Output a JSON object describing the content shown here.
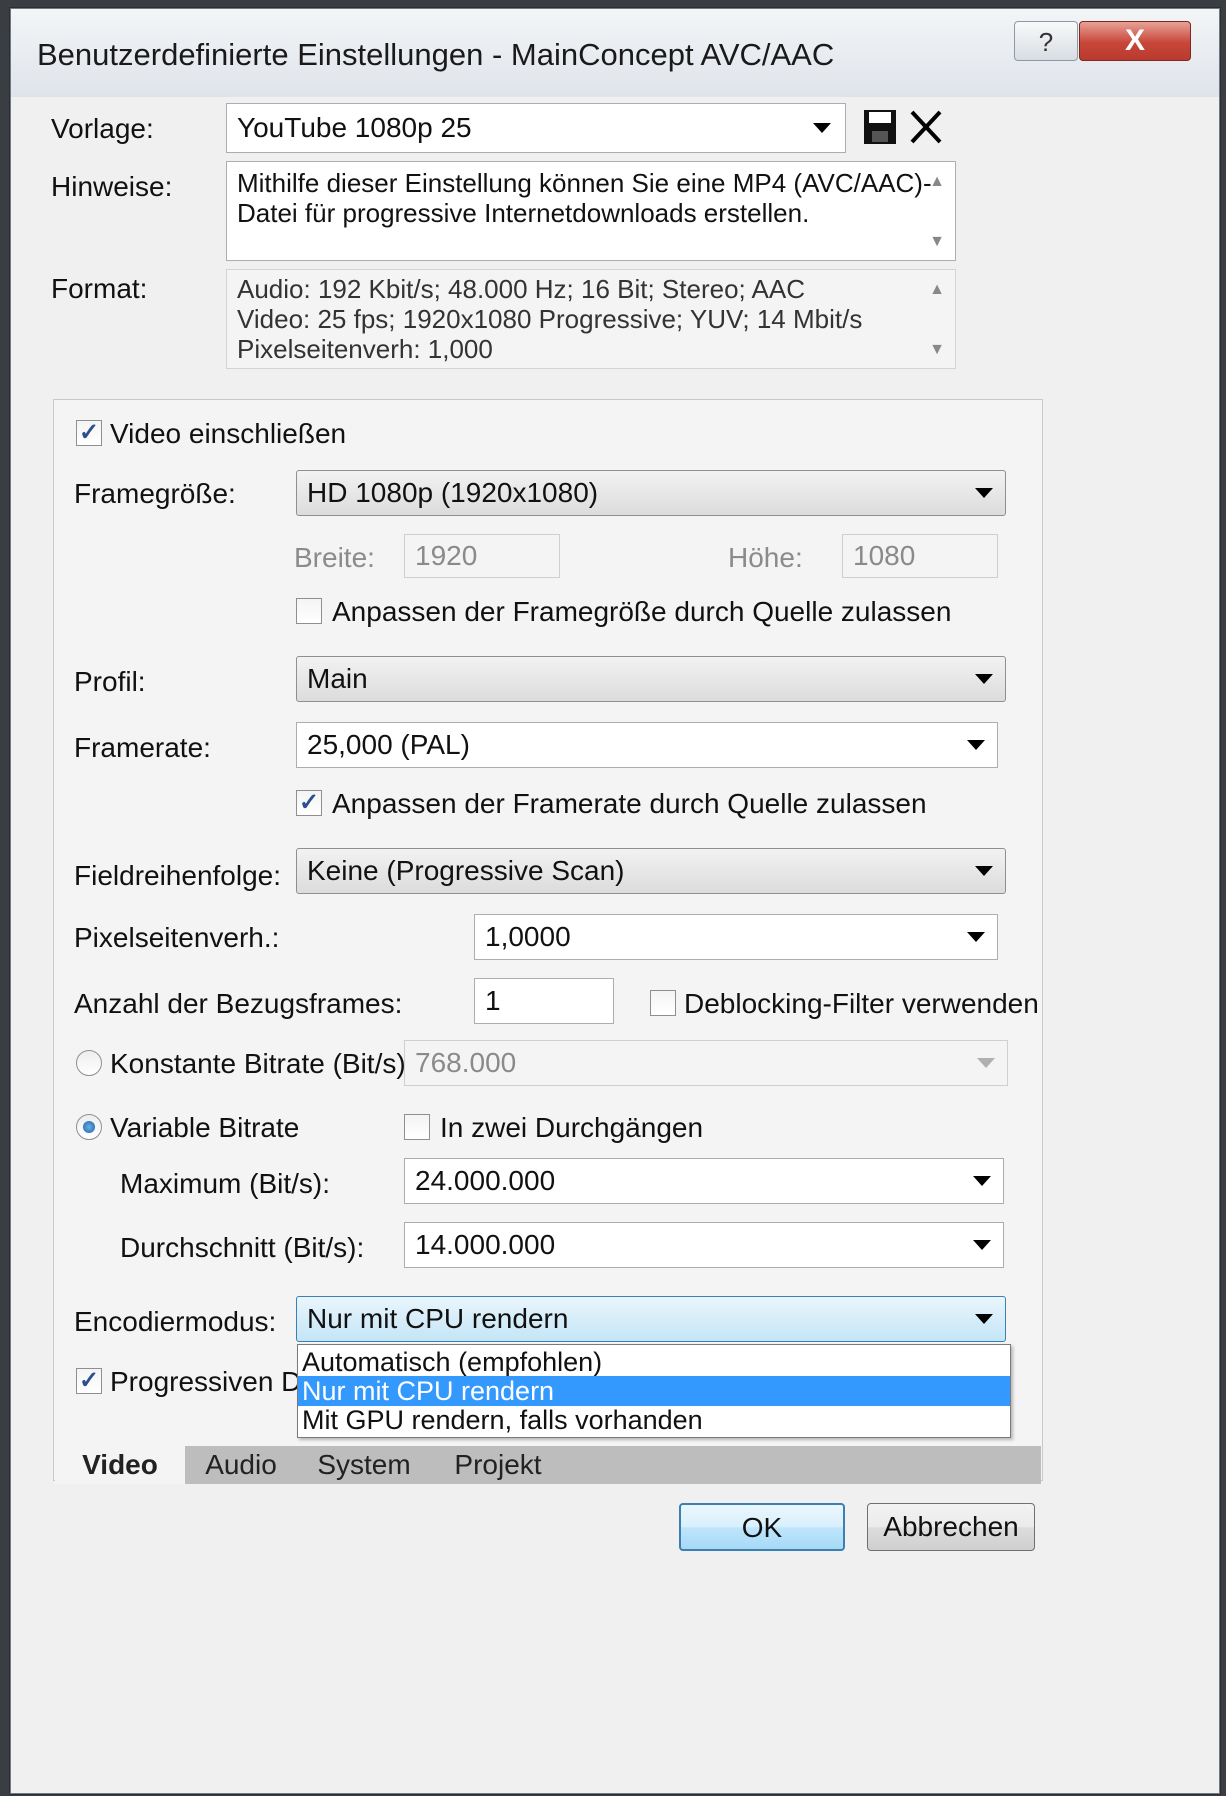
{
  "window": {
    "title": "Benutzerdefinierte Einstellungen - MainConcept AVC/AAC",
    "help_label": "?",
    "close_label": "X"
  },
  "template": {
    "vorlage_label": "Vorlage:",
    "vorlage_value": "YouTube 1080p 25",
    "save_icon": "floppy-disk-icon",
    "delete_icon": "x-delete-icon",
    "hinweise_label": "Hinweise:",
    "hinweise_lines": [
      "Mithilfe dieser Einstellung können Sie eine MP4 (AVC/AAC)-",
      "Datei für progressive Internetdownloads erstellen."
    ],
    "format_label": "Format:",
    "format_lines": [
      "Audio: 192 Kbit/s; 48.000 Hz; 16 Bit; Stereo; AAC",
      "Video: 25 fps; 1920x1080 Progressive; YUV; 14 Mbit/s",
      "Pixelseitenverh: 1,000"
    ]
  },
  "video": {
    "include_video_label": "Video einschließen",
    "include_video_checked": true,
    "framesize_label": "Framegröße:",
    "framesize_value": "HD 1080p (1920x1080)",
    "width_label": "Breite:",
    "width_value": "1920",
    "height_label": "Höhe:",
    "height_value": "1080",
    "allow_framesize_label": "Anpassen der Framegröße durch Quelle zulassen",
    "allow_framesize_checked": false,
    "profile_label": "Profil:",
    "profile_value": "Main",
    "framerate_label": "Framerate:",
    "framerate_value": "25,000 (PAL)",
    "allow_framerate_label": "Anpassen der Framerate durch Quelle zulassen",
    "allow_framerate_checked": true,
    "field_order_label": "Fieldreihenfolge:",
    "field_order_value": "Keine (Progressive Scan)",
    "pixel_aspect_label": "Pixelseitenverh.:",
    "pixel_aspect_value": "1,0000",
    "ref_frames_label": "Anzahl der Bezugsframes:",
    "ref_frames_value": "1",
    "deblocking_label": "Deblocking-Filter verwenden",
    "deblocking_checked": false,
    "cbr_label": "Konstante Bitrate (Bit/s):",
    "cbr_value": "768.000",
    "vbr_label": "Variable Bitrate",
    "two_pass_label": "In zwei Durchgängen",
    "two_pass_checked": false,
    "max_label": "Maximum (Bit/s):",
    "max_value": "24.000.000",
    "avg_label": "Durchschnitt (Bit/s):",
    "avg_value": "14.000.000",
    "encode_mode_label": "Encodiermodus:",
    "encode_mode_value": "Nur mit CPU rendern",
    "encode_mode_options": [
      "Automatisch (empfohlen)",
      "Nur mit CPU rendern",
      "Mit GPU rendern, falls vorhanden"
    ],
    "progressive_label": "Progressiven Dov",
    "progressive_checked": true
  },
  "tabs": [
    "Video",
    "Audio",
    "System",
    "Projekt"
  ],
  "buttons": {
    "ok": "OK",
    "cancel": "Abbrechen"
  },
  "colors": {
    "selection": "#3399ff",
    "close_button": "#c8463a",
    "accent": "#3c7fb1"
  }
}
